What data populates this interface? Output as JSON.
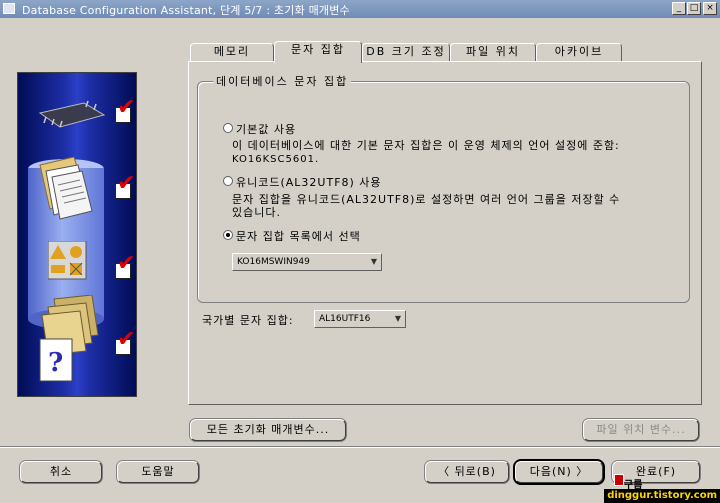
{
  "window": {
    "title": "Database Configuration Assistant, 단계 5/7 : 초기화 매개변수",
    "minimize_glyph": "_",
    "maximize_glyph": "□",
    "close_glyph": "×"
  },
  "tabs": [
    {
      "label": "메모리",
      "active": false
    },
    {
      "label": "문자 집합",
      "active": true
    },
    {
      "label": "DB 크기 조정",
      "active": false
    },
    {
      "label": "파일 위치",
      "active": false
    },
    {
      "label": "아카이브",
      "active": false
    }
  ],
  "charset_group": {
    "legend": "데이터베이스 문자 집합",
    "option_default": {
      "label": "기본값 사용",
      "desc1": "이 데이터베이스에 대한 기본 문자 집합은 이 운영 체제의 언어 설정에 준함:",
      "desc2": "KO16KSC5601."
    },
    "option_unicode": {
      "label": "유니코드(AL32UTF8) 사용",
      "desc1": "문자 집합을 유니코드(AL32UTF8)로 설정하면 여러 언어 그룹을 저장할 수",
      "desc2": "있습니다."
    },
    "option_list": {
      "label": "문자 집합 목록에서 선택",
      "selected_value": "KO16MSWIN949"
    },
    "selected_option": "list"
  },
  "national_charset": {
    "label": "국가별 문자 집합:",
    "value": "AL16UTF16"
  },
  "buttons": {
    "all_params": "모든 초기화 매개변수...",
    "file_location_vars": "파일 위치 변수...",
    "cancel": "취소",
    "help": "도움말",
    "back": "뒤로(B)",
    "next": "다음(N)",
    "finish": "완료(F)"
  },
  "watermark": "dinggur.tistory.com",
  "watermark_small": "구름"
}
